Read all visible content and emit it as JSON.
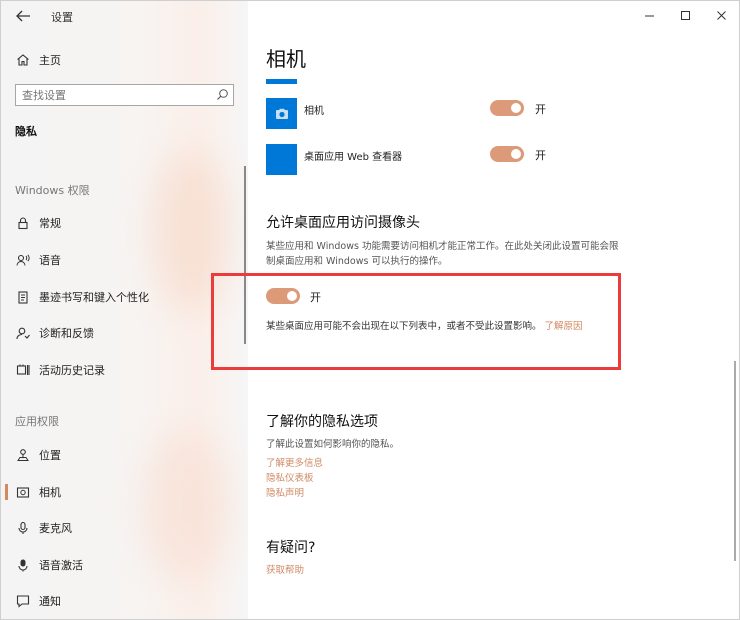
{
  "window": {
    "title": "设置",
    "controls": {
      "minimize": "minimize-icon",
      "maximize": "maximize-icon",
      "close": "close-icon"
    }
  },
  "sidebar": {
    "home_label": "主页",
    "search_placeholder": "查找设置",
    "privacy_heading": "隐私",
    "windows_permissions_label": "Windows 权限",
    "windows_items": [
      {
        "label": "常规",
        "icon": "lock-icon"
      },
      {
        "label": "语音",
        "icon": "speech-icon"
      },
      {
        "label": "墨迹书写和键入个性化",
        "icon": "notepad-icon"
      },
      {
        "label": "诊断和反馈",
        "icon": "diagnostics-icon"
      },
      {
        "label": "活动历史记录",
        "icon": "history-icon"
      }
    ],
    "app_permissions_label": "应用权限",
    "app_items": [
      {
        "label": "位置",
        "icon": "location-icon"
      },
      {
        "label": "相机",
        "icon": "camera-icon",
        "active": true
      },
      {
        "label": "麦克风",
        "icon": "microphone-icon"
      },
      {
        "label": "语音激活",
        "icon": "voice-activation-icon"
      },
      {
        "label": "通知",
        "icon": "notification-icon"
      }
    ]
  },
  "main": {
    "page_title": "相机",
    "apps": [
      {
        "name": "相机",
        "toggle_state": "开"
      },
      {
        "name": "桌面应用 Web 查看器",
        "toggle_state": "开"
      }
    ],
    "desktop_section": {
      "heading": "允许桌面应用访问摄像头",
      "description": "某些应用和 Windows 功能需要访问相机才能正常工作。在此处关闭此设置可能会限制桌面应用和 Windows 可以执行的操作。",
      "toggle_state": "开",
      "note": "某些桌面应用可能不会出现在以下列表中，或者不受此设置影响。",
      "learn_more": "了解原因"
    },
    "privacy_options": {
      "title": "了解你的隐私选项",
      "description": "了解此设置如何影响你的隐私。",
      "links": [
        "了解更多信息",
        "隐私仪表板",
        "隐私声明"
      ]
    },
    "question": {
      "title": "有疑问?",
      "link": "获取帮助"
    }
  },
  "colors": {
    "accent": "#0078d7",
    "toggle_on": "#dd9a79",
    "link": "#d08a64",
    "highlight_border": "#ec3b3b"
  }
}
